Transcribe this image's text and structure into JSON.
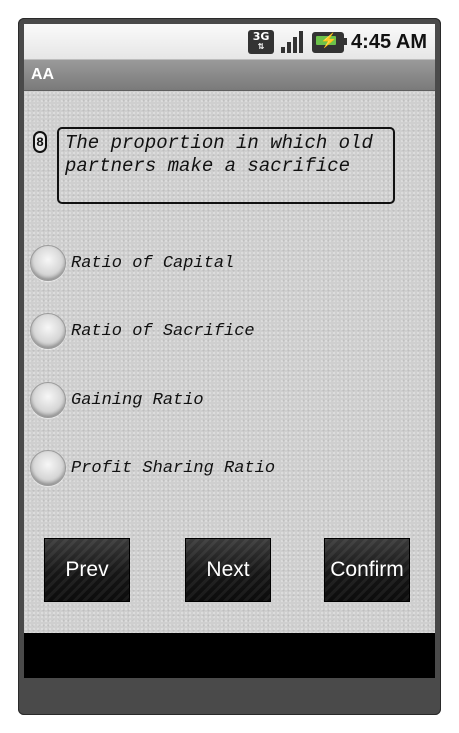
{
  "status_bar": {
    "network_label": "3G",
    "clock": "4:45 AM",
    "icons": [
      "3g-icon",
      "signal-icon",
      "battery-charging-icon"
    ],
    "battery_color": "#6cc24a"
  },
  "app_bar": {
    "title": "AA"
  },
  "question": {
    "number": "8",
    "text": "The proportion in which old partners make a sacrifice"
  },
  "options": [
    {
      "label": "Ratio of Capital",
      "selected": false
    },
    {
      "label": "Ratio of Sacrifice",
      "selected": false
    },
    {
      "label": "Gaining Ratio",
      "selected": false
    },
    {
      "label": "Profit Sharing Ratio",
      "selected": false
    }
  ],
  "buttons": {
    "prev": "Prev",
    "next": "Next",
    "confirm": "Confirm"
  }
}
